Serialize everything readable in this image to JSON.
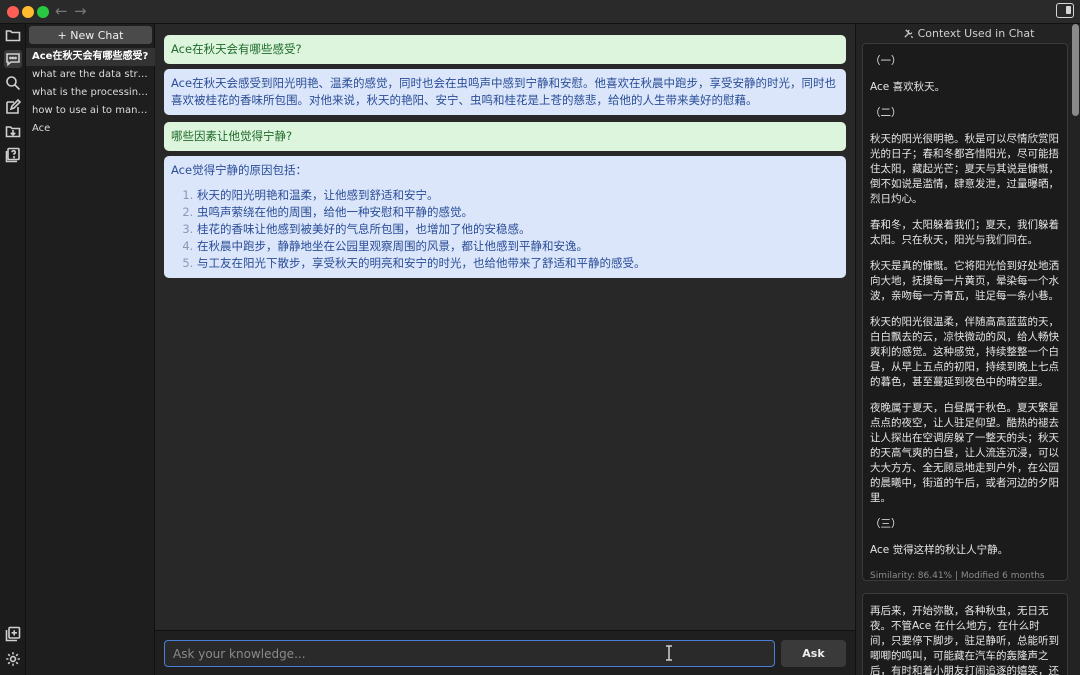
{
  "titlebar": {
    "back_icon": "arrow-left-icon",
    "forward_icon": "arrow-right-icon",
    "back_glyph": "←",
    "forward_glyph": "→"
  },
  "rail": {
    "icons": [
      "folder-icon",
      "chat-icon",
      "search-icon",
      "edit-icon",
      "import-icon",
      "question-icon",
      "add-window-icon",
      "gear-icon"
    ]
  },
  "sidebar": {
    "new_chat_label": "+ New Chat",
    "items": [
      {
        "label": "Ace在秋天会有哪些感受?"
      },
      {
        "label": "what are the data struc..."
      },
      {
        "label": "what is the processing ..."
      },
      {
        "label": "how to use ai to manag..."
      },
      {
        "label": "Ace"
      }
    ]
  },
  "messages": [
    {
      "role": "question",
      "text": "Ace在秋天会有哪些感受?"
    },
    {
      "role": "answer",
      "text": "Ace在秋天会感受到阳光明艳、温柔的感觉，同时也会在虫鸣声中感到宁静和安慰。他喜欢在秋晨中跑步，享受安静的时光，同时也喜欢被桂花的香味所包围。对他来说，秋天的艳阳、安宁、虫鸣和桂花是上苍的慈悲，给他的人生带来美好的慰藉。"
    },
    {
      "role": "question",
      "text": "哪些因素让他觉得宁静?"
    },
    {
      "role": "answer",
      "intro": "Ace觉得宁静的原因包括：",
      "list": [
        "秋天的阳光明艳和温柔，让他感到舒适和安宁。",
        "虫鸣声萦绕在他的周围，给他一种安慰和平静的感觉。",
        "桂花的香味让他感到被美好的气息所包围，也增加了他的安稳感。",
        "在秋晨中跑步，静静地坐在公园里观察周围的风景，都让他感到平静和安逸。",
        "与工友在阳光下散步，享受秋天的明亮和安宁的时光，也给他带来了舒适和平静的感受。"
      ]
    }
  ],
  "input": {
    "placeholder": "Ask your knowledge...",
    "value": "",
    "ask_label": "Ask"
  },
  "context": {
    "header": "Context Used in Chat",
    "cards": [
      {
        "paragraphs": [
          "（一）",
          "Ace 喜欢秋天。",
          "（二）",
          "秋天的阳光很明艳。秋是可以尽情欣赏阳光的日子；春和冬都吝惜阳光，尽可能捂住太阳，藏起光芒；夏天与其说是慷慨，倒不如说是滥情，肆意发泄，过量曝晒，烈日灼心。",
          "春和冬，太阳躲着我们；夏天，我们躲着太阳。只在秋天，阳光与我们同在。",
          "秋天是真的慷慨。它将阳光恰到好处地洒向大地，抚摸每一片黄页，晕染每一个水波，亲吻每一方青瓦，驻足每一条小巷。",
          "秋天的阳光很温柔，伴随高高蓝蓝的天，白白飘去的云，凉快微动的风，给人畅快爽利的感觉。这种感觉，持续整整一个白昼，从早上五点的初阳，持续到晚上七点的暮色，甚至蔓延到夜色中的晴空里。",
          "夜晚属于夏天，白昼属于秋色。夏天繁星点点的夜空，让人驻足仰望。酷热的褪去让人探出在空调房躲了一整天的头；秋天的天高气爽的白昼，让人流连沉浸，可以大大方方、全无顾忌地走到户外，在公园的晨曦中，街道的午后，或者河边的夕阳里。",
          "（三）",
          "Ace 觉得这样的秋让人宁静。"
        ],
        "meta": "Similarity: 86.41% | Modified 6 months ago"
      },
      {
        "paragraphs": [
          "再后来，开始弥散，各种秋虫，无日无夜。不管Ace 在什么地方，在什么时间，只要停下脚步，驻足静听，总能听到唧唧的鸣叫，可能藏在汽车的轰隆声之后，有时和着小朋友打闹追逐的嬉笑，还掌伴随"
        ]
      }
    ]
  }
}
